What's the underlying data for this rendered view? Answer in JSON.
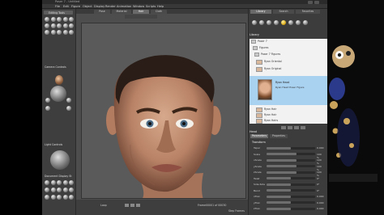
{
  "titlebar": {
    "title": "Poser 7 - Untitled"
  },
  "menu": [
    "File",
    "Edit",
    "Figure",
    "Object",
    "Display",
    "Render",
    "Animation",
    "Window",
    "Scripts",
    "Help"
  ],
  "left": {
    "tab_label": "Editing Tools",
    "camera_controls_title": "Camera Controls",
    "light_controls_title": "Light Controls",
    "document_display_title": "Document Display St"
  },
  "viewport": {
    "tabs": [
      "Pose",
      "Material",
      "Hair",
      "Cloth"
    ],
    "active_tab": "Hair",
    "camera_label": "Face Camera",
    "timeline_label": "Frame",
    "frame_counter": "00001 of 00030",
    "end_label": "Step Frames",
    "loop_label": "Loop"
  },
  "right": {
    "tabs": [
      "Library",
      "Search",
      "Favorites"
    ],
    "path_label": "Library",
    "list_items": [
      {
        "name": "Poser 7",
        "indent": 0
      },
      {
        "name": "Figures",
        "indent": 1
      },
      {
        "name": "Poser 7 Figures",
        "indent": 2
      },
      {
        "name": "Ryan Oriental",
        "indent": 3
      },
      {
        "name": "Ryan Original",
        "indent": 3
      }
    ],
    "selected_item": {
      "name": "Ryan Head",
      "caption": "Ryan Head Poser Figure"
    },
    "list_items_after": [
      {
        "name": "Ryan Hair"
      },
      {
        "name": "Ryan Hair"
      },
      {
        "name": "Ryan Hairs"
      }
    ],
    "param_panel_title": "Head",
    "param_tabs": [
      "Parameters",
      "Properties"
    ],
    "group_title": "Transform",
    "params": [
      {
        "label": "Taper",
        "value": "0.000",
        "level": 0.5
      },
      {
        "label": "Scale",
        "value": "100 %",
        "level": 0.62
      },
      {
        "label": "xScale",
        "value": "100 %",
        "level": 0.62
      },
      {
        "label": "yScale",
        "value": "100 %",
        "level": 0.62
      },
      {
        "label": "zScale",
        "value": "100 %",
        "level": 0.62
      },
      {
        "label": "Twist",
        "value": "0°",
        "level": 0.5
      },
      {
        "label": "Side-Side",
        "value": "0°",
        "level": 0.5
      },
      {
        "label": "Bend",
        "value": "0°",
        "level": 0.5
      },
      {
        "label": "xTran",
        "value": "0.000",
        "level": 0.5
      },
      {
        "label": "yTran",
        "value": "0.000",
        "level": 0.5
      },
      {
        "label": "zTran",
        "value": "0.000",
        "level": 0.5
      }
    ]
  }
}
